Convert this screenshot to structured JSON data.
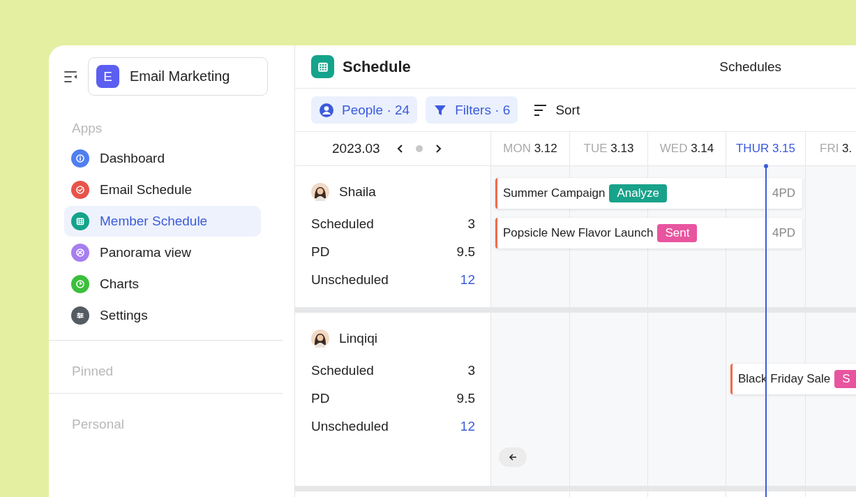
{
  "workspace": {
    "initial": "E",
    "name": "Email Marketing"
  },
  "sidebar": {
    "sections": [
      {
        "title": "Apps",
        "items": [
          {
            "label": "Dashboard",
            "color": "#4f7ff0",
            "selected": false
          },
          {
            "label": "Email Schedule",
            "color": "#e8534a",
            "selected": false
          },
          {
            "label": "Member Schedule",
            "color": "#14a38b",
            "selected": true
          },
          {
            "label": "Panorama view",
            "color": "#a67ef0",
            "selected": false
          },
          {
            "label": "Charts",
            "color": "#3cbf3c",
            "selected": false
          },
          {
            "label": "Settings",
            "color": "#555b63",
            "selected": false
          }
        ]
      },
      {
        "title": "Pinned"
      },
      {
        "title": "Personal"
      }
    ]
  },
  "header": {
    "title": "Schedule",
    "right": "Schedules"
  },
  "toolbar": [
    {
      "kind": "people",
      "label": "People · 24"
    },
    {
      "kind": "filter",
      "label": "Filters · 6"
    },
    {
      "kind": "sort",
      "label": "Sort"
    }
  ],
  "calendar": {
    "month": "2023.03",
    "days": [
      {
        "day": "MON",
        "date": "3.12",
        "today": false
      },
      {
        "day": "TUE",
        "date": "3.13",
        "today": false
      },
      {
        "day": "WED",
        "date": "3.14",
        "today": false
      },
      {
        "day": "THUR",
        "date": "3.15",
        "today": true
      },
      {
        "day": "FRI",
        "date": "3.",
        "today": false
      }
    ],
    "people": [
      {
        "name": "Shaila",
        "stats": [
          {
            "label": "Scheduled",
            "value": "3",
            "kind": "count"
          },
          {
            "label": "PD",
            "value": "9.5",
            "kind": "count"
          },
          {
            "label": "Unscheduled",
            "value": "12",
            "kind": "link"
          }
        ],
        "events": [
          {
            "title": "Summer Campaign",
            "badge": "Analyze",
            "color": "#18a28a",
            "pd": "4PD"
          },
          {
            "title": "Popsicle New Flavor Launch",
            "badge": "Sent",
            "color": "#e8559f",
            "pd": "4PD"
          }
        ]
      },
      {
        "name": "Linqiqi",
        "stats": [
          {
            "label": "Scheduled",
            "value": "3",
            "kind": "count"
          },
          {
            "label": "PD",
            "value": "9.5",
            "kind": "count"
          },
          {
            "label": "Unscheduled",
            "value": "12",
            "kind": "link"
          }
        ],
        "events": [
          {
            "title": "Black Friday Sale",
            "badge": "S",
            "color": "#e8559f"
          }
        ]
      }
    ]
  }
}
